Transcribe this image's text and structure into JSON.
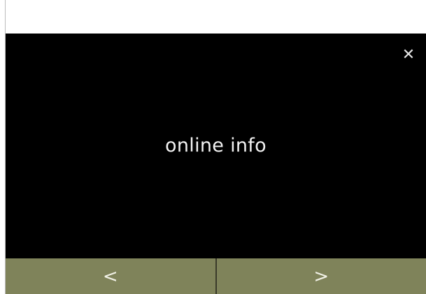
{
  "screen": {
    "title": "online info",
    "close_icon": "close-icon",
    "close_glyph": "✕"
  },
  "nav": {
    "prev_glyph": "<",
    "next_glyph": ">",
    "bar_color": "#7f835a"
  }
}
